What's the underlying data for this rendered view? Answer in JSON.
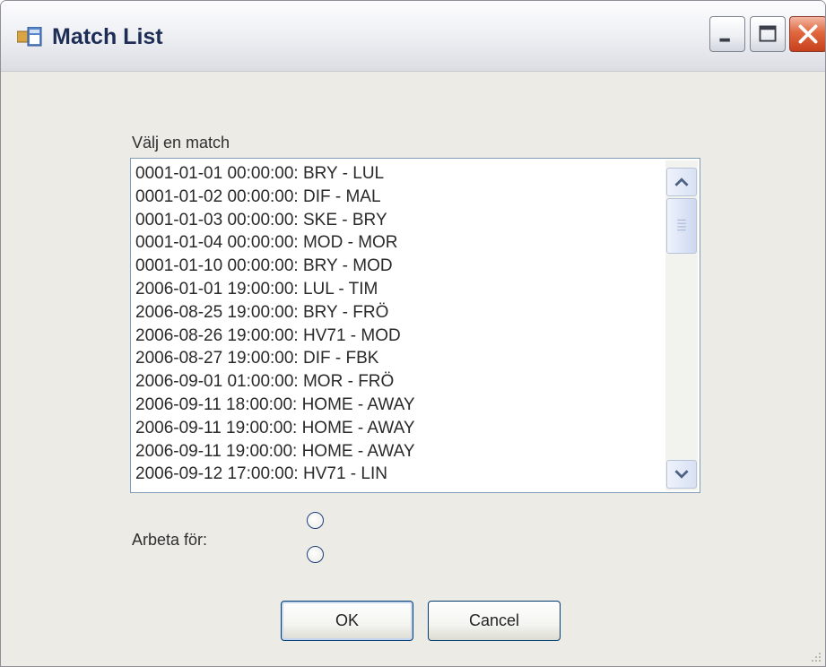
{
  "window": {
    "title": "Match List",
    "app_icon": "form-window-icon",
    "controls": {
      "minimize_icon": "minimize-icon",
      "maximize_icon": "maximize-icon",
      "close_icon": "close-icon"
    },
    "colors": {
      "title_text": "#1d2d55",
      "close_button": "#d85a32",
      "client_bg": "#ecebe6"
    }
  },
  "form": {
    "select_label": "Välj en match",
    "matches": [
      "0001-01-01 00:00:00: BRY - LUL",
      "0001-01-02 00:00:00: DIF - MAL",
      "0001-01-03 00:00:00: SKE - BRY",
      "0001-01-04 00:00:00: MOD - MOR",
      "0001-01-10 00:00:00: BRY - MOD",
      "2006-01-01 19:00:00: LUL - TIM",
      "2006-08-25 19:00:00: BRY - FRÖ",
      "2006-08-26 19:00:00: HV71 - MOD",
      "2006-08-27 19:00:00: DIF - FBK",
      "2006-09-01 01:00:00: MOR - FRÖ",
      "2006-09-11 18:00:00: HOME - AWAY",
      "2006-09-11 19:00:00: HOME - AWAY",
      "2006-09-11 19:00:00: HOME - AWAY",
      "2006-09-12 17:00:00: HV71 - LIN"
    ],
    "scroll_up_icon": "chevron-up-icon",
    "scroll_down_icon": "chevron-down-icon",
    "work_for_label": "Arbeta för:",
    "radio_options": [
      {
        "label": "",
        "checked": false
      },
      {
        "label": "",
        "checked": false
      }
    ],
    "ok_label": "OK",
    "cancel_label": "Cancel"
  }
}
